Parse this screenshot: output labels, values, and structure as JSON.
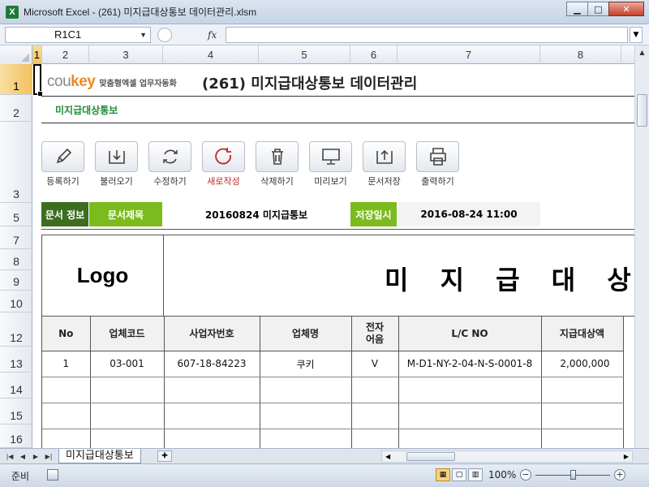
{
  "window": {
    "title": "Microsoft Excel - (261) 미지급대상통보 데이터관리.xlsm",
    "app_icon_letter": "X",
    "min": "▁",
    "max": "□",
    "close": "✕"
  },
  "formula_bar": {
    "name_box": "R1C1",
    "fx": "fx",
    "formula": ""
  },
  "columns": [
    "1",
    "2",
    "3",
    "4",
    "5",
    "6",
    "7",
    "8"
  ],
  "rows": [
    "1",
    "2",
    "3",
    "5",
    "7",
    "8",
    "9",
    "10",
    "12",
    "13",
    "14",
    "15",
    "16"
  ],
  "header": {
    "brand_cou": "cou",
    "brand_key": "key",
    "slogan": "맞춤형엑셀 업무자동화",
    "title": "(261) 미지급대상통보 데이터관리",
    "subtitle": "미지급대상통보"
  },
  "toolbar": [
    {
      "label": "등록하기",
      "icon": "pencil-icon"
    },
    {
      "label": "불러오기",
      "icon": "download-tray-icon"
    },
    {
      "label": "수정하기",
      "icon": "refresh-icon"
    },
    {
      "label": "새로작성",
      "icon": "new-circle-icon"
    },
    {
      "label": "삭제하기",
      "icon": "trash-icon"
    },
    {
      "label": "미리보기",
      "icon": "monitor-icon"
    },
    {
      "label": "문서저장",
      "icon": "upload-tray-icon"
    },
    {
      "label": "출력하기",
      "icon": "printer-icon"
    }
  ],
  "info": {
    "doc_info_label": "문서 정보",
    "doc_title_label": "문서제목",
    "doc_title_value": "20160824 미지급통보",
    "saved_label": "저장일시",
    "saved_value": "2016-08-24 11:00"
  },
  "document": {
    "logo": "Logo",
    "title": "미 지 급 대 상 통 보"
  },
  "table": {
    "headers": [
      "No",
      "업체코드",
      "사업자번호",
      "업체명",
      "전자\n어음",
      "L/C NO",
      "지급대상액"
    ],
    "rows": [
      [
        "1",
        "03-001",
        "607-18-84223",
        "쿠키",
        "V",
        "M-D1-NY-2-04-N-S-0001-8",
        "2,000,000"
      ]
    ]
  },
  "tabs": {
    "sheet_name": "미지급대상통보"
  },
  "status": {
    "text": "준비",
    "zoom": "100%"
  }
}
